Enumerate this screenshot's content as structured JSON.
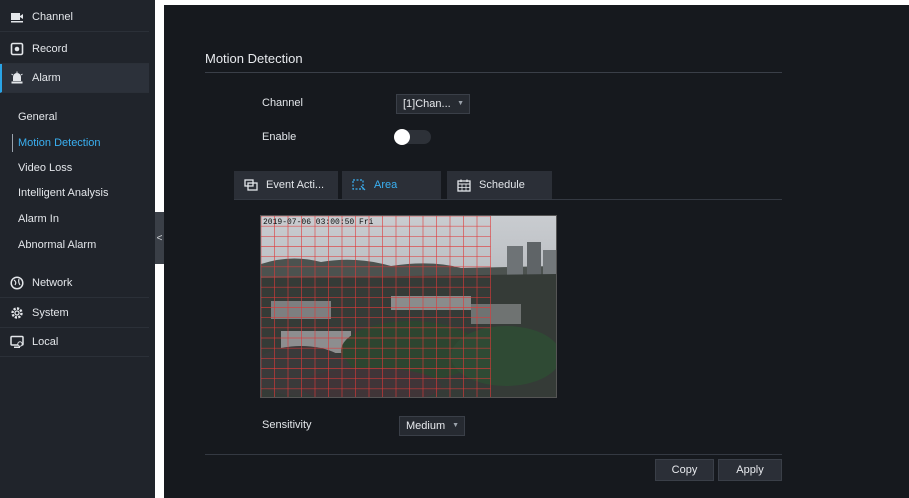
{
  "sidebar": {
    "items": [
      {
        "label": "Channel",
        "icon": "channel-icon"
      },
      {
        "label": "Record",
        "icon": "record-icon"
      },
      {
        "label": "Alarm",
        "icon": "alarm-icon"
      },
      {
        "label": "Network",
        "icon": "network-icon"
      },
      {
        "label": "System",
        "icon": "system-icon"
      },
      {
        "label": "Local",
        "icon": "local-icon"
      }
    ],
    "alarm_sub": [
      "General",
      "Motion Detection",
      "Video Loss",
      "Intelligent Analysis",
      "Alarm In",
      "Abnormal Alarm"
    ],
    "collapse_glyph": "<"
  },
  "main": {
    "title": "Motion Detection",
    "channel_label": "Channel",
    "channel_value": "[1]Chan...",
    "enable_label": "Enable",
    "enable_on": false,
    "tabs": [
      {
        "label": "Event Acti...",
        "icon": "event-action-icon"
      },
      {
        "label": "Area",
        "icon": "area-icon"
      },
      {
        "label": "Schedule",
        "icon": "calendar-icon"
      }
    ],
    "video_timestamp": "2019-07-06 03:00:50 Fri",
    "sensitivity_label": "Sensitivity",
    "sensitivity_value": "Medium",
    "copy_label": "Copy",
    "apply_label": "Apply"
  },
  "colors": {
    "sidebar_bg": "#20242b",
    "main_bg": "#16191e",
    "accent": "#2aa4e6",
    "grid_line": "#e03a3a"
  }
}
